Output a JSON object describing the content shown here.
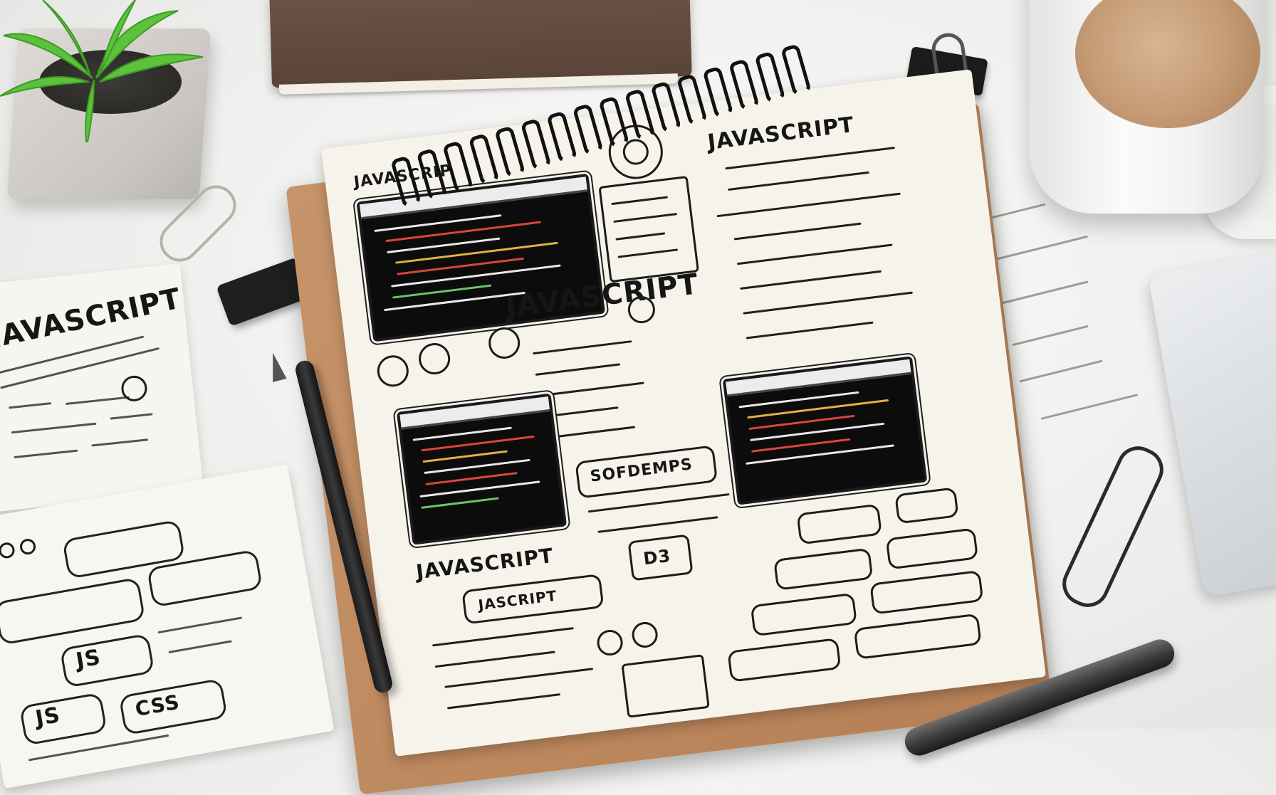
{
  "notebook": {
    "title_main": "JAVASCRIPT",
    "title_top_right": "JAVASCRIPT",
    "title_top_left": "JAVASCRIP",
    "title_bottom": "JAVASCRIPT",
    "title_bottom_small": "JASCRIPT",
    "box_label": "SOFDEMPS",
    "d3_label": "D3"
  },
  "sheet_left_top": {
    "title": "JAVASCRIPT"
  },
  "sheet_left_bottom": {
    "label_a": "JS",
    "label_b": "JS",
    "label_c": "CSS"
  },
  "colors": {
    "code_red": "#d9463b",
    "code_white": "#e8e8e8",
    "code_yellow": "#e3b23c",
    "code_green": "#6cc36a",
    "notebook_cover": "#b57f55",
    "paper": "#f6f3ea",
    "coffee": "#c49a74",
    "plant_green": "#5cc23b"
  }
}
